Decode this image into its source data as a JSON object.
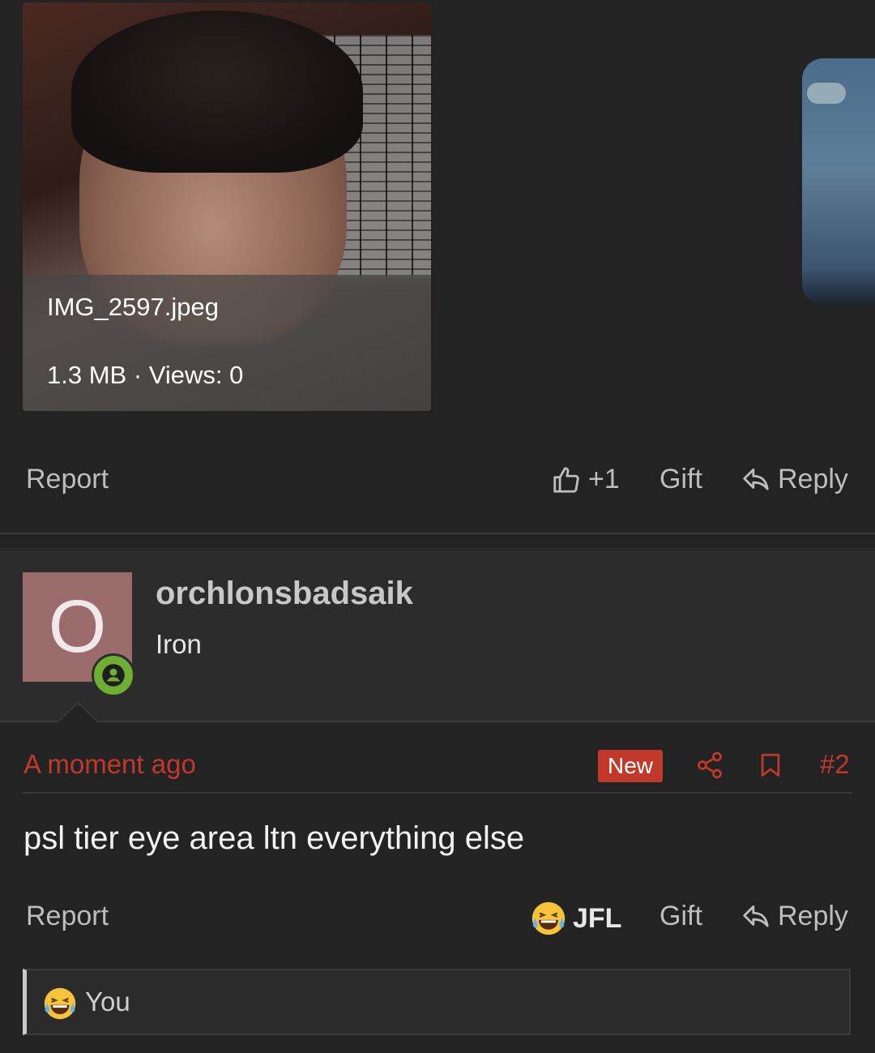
{
  "attachment": {
    "filename": "IMG_2597.jpeg",
    "meta": "1.3 MB · Views: 0"
  },
  "first_post_actions": {
    "report": "Report",
    "like_count": "+1",
    "gift": "Gift",
    "reply": "Reply"
  },
  "post": {
    "avatar_letter": "O",
    "username": "orchlonsbadsaik",
    "rank": "Iron",
    "time": "A moment ago",
    "new_badge": "New",
    "post_number": "#2",
    "body": "psl tier eye area ltn everything else"
  },
  "second_post_actions": {
    "report": "Report",
    "reaction_label": "JFL",
    "gift": "Gift",
    "reply": "Reply"
  },
  "reaction_summary": {
    "label": "You"
  },
  "colors": {
    "background": "#232323",
    "accent_red": "#c0392b",
    "online_green": "#6dae33",
    "avatar_bg": "#9b6c6b"
  },
  "icons": [
    "thumbs-up-icon",
    "reply-arrow-icon",
    "share-icon",
    "bookmark-icon",
    "laughing-emoji-icon",
    "online-user-icon"
  ]
}
